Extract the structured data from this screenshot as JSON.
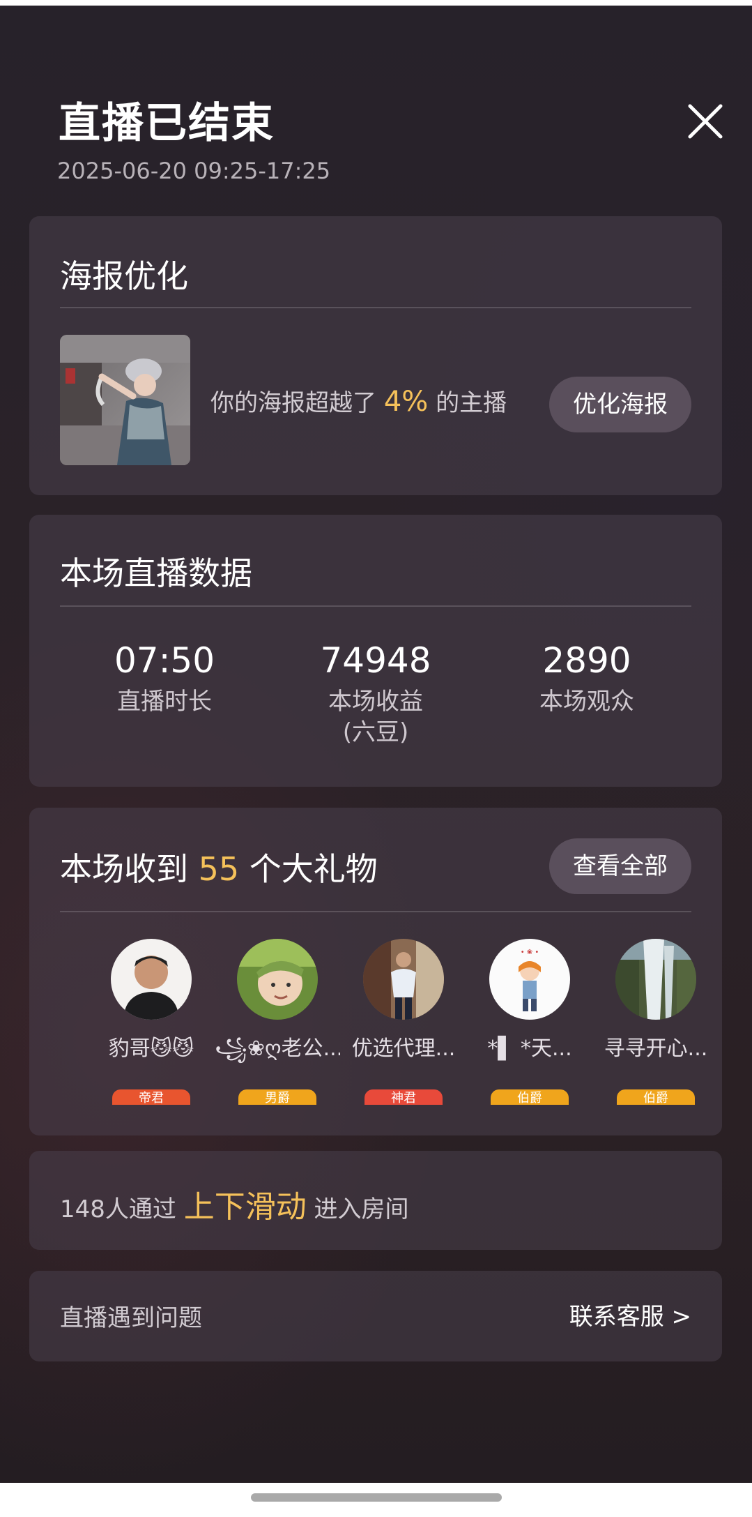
{
  "header": {
    "title": "直播已结束",
    "datetime": "2025-06-20 09:25-17:25"
  },
  "poster_card": {
    "title": "海报优化",
    "text_before": "你的海报超越了",
    "percent": "4%",
    "text_after": "的主播",
    "button_label": "优化海报"
  },
  "stats_card": {
    "title": "本场直播数据",
    "stats": [
      {
        "value": "07:50",
        "label": "直播时长"
      },
      {
        "value": "74948",
        "label": "本场收益\n(六豆)"
      },
      {
        "value": "2890",
        "label": "本场观众"
      }
    ]
  },
  "gifts_card": {
    "title_prefix": "本场收到",
    "count": "55",
    "title_suffix": "个大礼物",
    "button_label": "查看全部",
    "users": [
      {
        "name": "豹哥😼😼",
        "badge_text": "帝君",
        "badge_color": "#e8552f"
      },
      {
        "name": "꧁❀ღ老公...",
        "badge_text": "男爵",
        "badge_color": "#f0a51c"
      },
      {
        "name": "优选代理...",
        "badge_text": "神君",
        "badge_color": "#e84a3a"
      },
      {
        "name": "*▌ *天...",
        "badge_text": "伯爵",
        "badge_color": "#f0a51c"
      },
      {
        "name": "寻寻开心...",
        "badge_text": "伯爵",
        "badge_color": "#f0a51c"
      }
    ]
  },
  "swipe_card": {
    "count_text": "148人通过",
    "highlight": "上下滑动",
    "suffix": "进入房间"
  },
  "support_card": {
    "label": "直播遇到问题",
    "link": "联系客服 >"
  },
  "colors": {
    "accent": "#f5c15a",
    "pill_bg": "#5a4f5c"
  }
}
